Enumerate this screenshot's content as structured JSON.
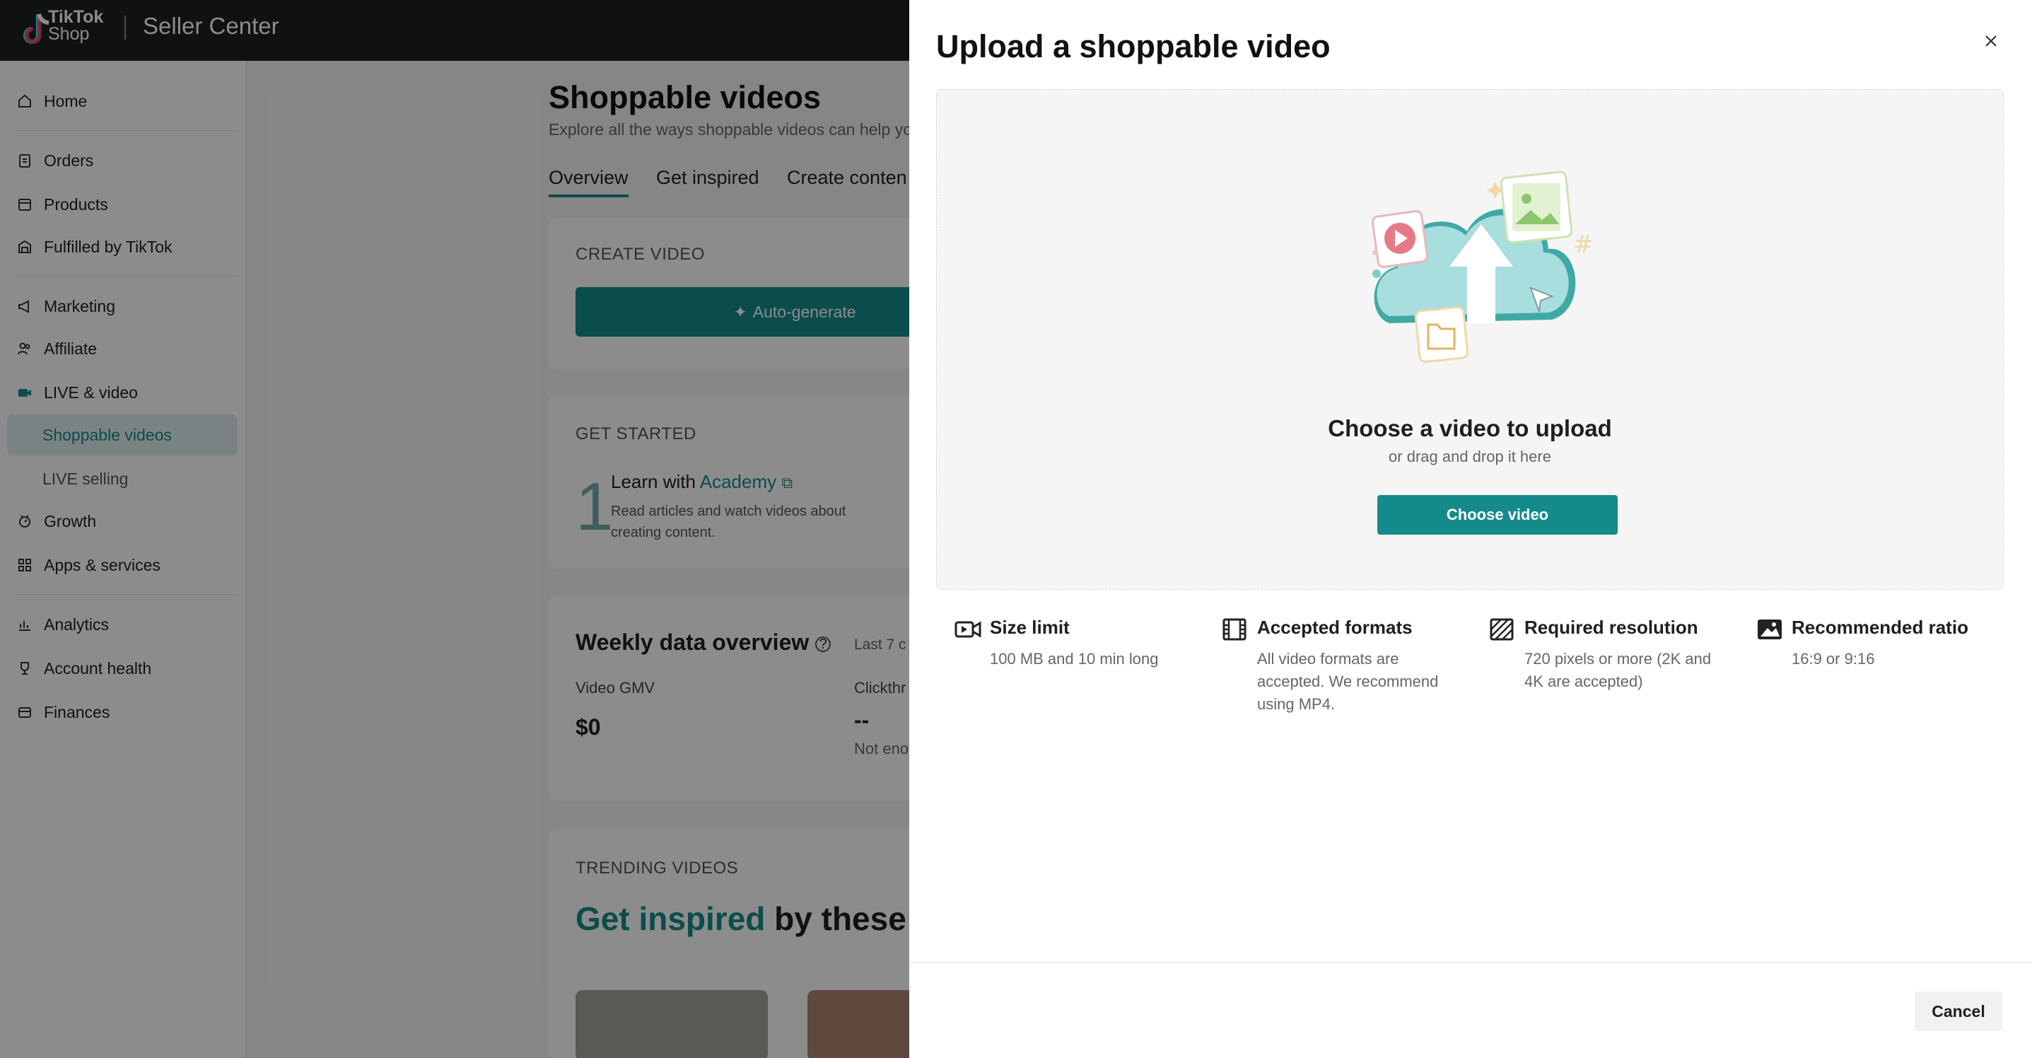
{
  "topbar": {
    "logo_line1": "TikTok",
    "logo_line2": "Shop",
    "title": "Seller Center"
  },
  "sidebar": {
    "items": [
      {
        "label": "Home",
        "icon": "home-icon"
      },
      {
        "label": "Orders",
        "icon": "clipboard-icon"
      },
      {
        "label": "Products",
        "icon": "box-icon"
      },
      {
        "label": "Fulfilled by TikTok",
        "icon": "warehouse-icon"
      },
      {
        "label": "Marketing",
        "icon": "megaphone-icon"
      },
      {
        "label": "Affiliate",
        "icon": "people-icon"
      },
      {
        "label": "LIVE & video",
        "icon": "video-icon"
      },
      {
        "label": "Shoppable videos"
      },
      {
        "label": "LIVE selling"
      },
      {
        "label": "Growth",
        "icon": "growth-icon"
      },
      {
        "label": "Apps & services",
        "icon": "apps-icon"
      },
      {
        "label": "Analytics",
        "icon": "chart-icon"
      },
      {
        "label": "Account health",
        "icon": "trophy-icon"
      },
      {
        "label": "Finances",
        "icon": "wallet-icon"
      }
    ]
  },
  "main": {
    "title": "Shoppable videos",
    "subtitle": "Explore all the ways shoppable videos can help yo",
    "tabs": [
      "Overview",
      "Get inspired",
      "Create conten"
    ],
    "create_label": "CREATE VIDEO",
    "auto_generate": "Auto-generate",
    "get_started_label": "GET STARTED",
    "step_number": "1",
    "learn_prefix": "Learn with ",
    "learn_link": "Academy",
    "learn_desc": "Read articles and watch videos about creating content.",
    "weekly_title": "Weekly data overview",
    "weekly_range": "Last 7 c",
    "gmv_label": "Video GMV",
    "gmv_value": "$0",
    "ctr_label": "Clickthr",
    "ctr_value": "--",
    "ctr_note": "Not eno",
    "trending_label": "TRENDING VIDEOS",
    "trending_highlight": "Get inspired",
    "trending_rest": " by these t"
  },
  "drawer": {
    "title": "Upload a shoppable video",
    "dropzone_title": "Choose a video to upload",
    "dropzone_sub": "or drag and drop it here",
    "choose_button": "Choose video",
    "info": [
      {
        "title": "Size limit",
        "desc": "100 MB and 10 min long",
        "icon": "video-size-icon"
      },
      {
        "title": "Accepted formats",
        "desc": "All video formats are accepted. We recommend using MP4.",
        "icon": "film-icon"
      },
      {
        "title": "Required resolution",
        "desc": "720 pixels or more (2K and 4K are accepted)",
        "icon": "resolution-icon"
      },
      {
        "title": "Recommended ratio",
        "desc": "16:9 or 9:16",
        "icon": "ratio-icon"
      }
    ],
    "cancel": "Cancel"
  },
  "colors": {
    "accent": "#148b8a",
    "topbar": "#1c1f23"
  }
}
